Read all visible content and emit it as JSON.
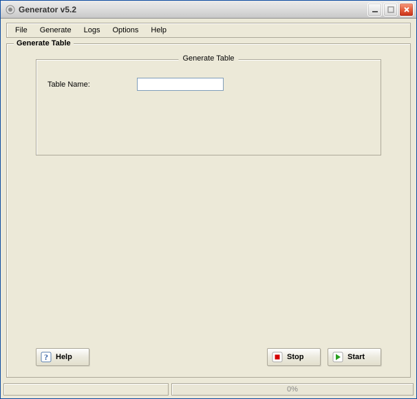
{
  "window": {
    "title": "Generator v5.2"
  },
  "menu": {
    "file": "File",
    "generate": "Generate",
    "logs": "Logs",
    "options": "Options",
    "help": "Help"
  },
  "panel": {
    "title": "Generate Table",
    "inner_title": "Generate Table",
    "table_name_label": "Table Name:",
    "table_name_value": ""
  },
  "buttons": {
    "help": "Help",
    "stop": "Stop",
    "start": "Start"
  },
  "status": {
    "left": "",
    "progress_label": "0%"
  },
  "colors": {
    "bg": "#ece9d8",
    "border": "#aca899",
    "stop_icon": "#d40000",
    "start_icon": "#2aa01f"
  }
}
